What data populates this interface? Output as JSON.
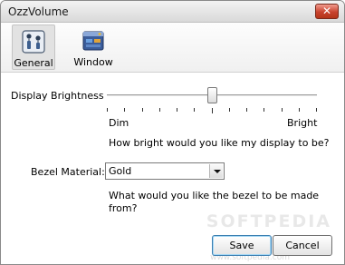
{
  "window": {
    "title": "OzzVolume",
    "close_glyph": "✕"
  },
  "toolbar": {
    "tabs": [
      {
        "label": "General",
        "icon": "general-settings-icon",
        "active": true
      },
      {
        "label": "Window",
        "icon": "window-icon",
        "active": false
      }
    ]
  },
  "brightness": {
    "label": "Display Brightness",
    "min_label": "Dim",
    "max_label": "Bright",
    "value_fraction": 0.5,
    "help": "How bright would you like my display to be?"
  },
  "bezel": {
    "label": "Bezel Material:",
    "selected": "Gold",
    "help_line1": "What would you like the bezel to be made",
    "help_line2": "from?"
  },
  "buttons": {
    "save": "Save",
    "cancel": "Cancel"
  },
  "watermark": {
    "text": "SOFTPEDIA",
    "sub": "www.softpedia.com"
  },
  "colors": {
    "close_button": "#c8432e",
    "accent_border": "#3c7fb1"
  }
}
